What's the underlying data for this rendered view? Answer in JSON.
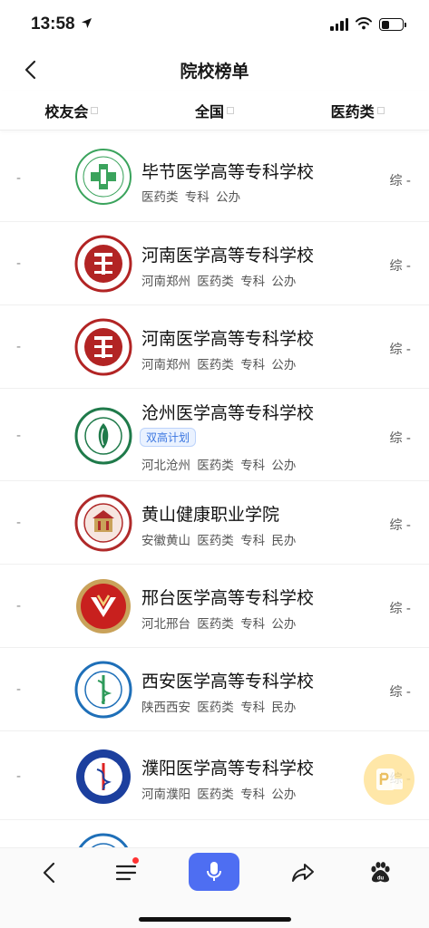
{
  "status_bar": {
    "time": "13:58"
  },
  "nav": {
    "title": "院校榜单"
  },
  "filters": [
    {
      "label": "校友会"
    },
    {
      "label": "全国"
    },
    {
      "label": "医药类"
    }
  ],
  "schools": [
    {
      "rank": "-",
      "name": "毕节医学高等专科学校",
      "meta": "医药类 专科 公办",
      "tag": "",
      "score": "综 -",
      "logo_color": "#3aa35c",
      "logo_style": "green-ring"
    },
    {
      "rank": "-",
      "name": "河南医学高等专科学校",
      "meta": "河南郑州 医药类 专科 公办",
      "tag": "",
      "score": "综 -",
      "logo_color": "#b22424",
      "logo_style": "red-seal"
    },
    {
      "rank": "-",
      "name": "河南医学高等专科学校",
      "meta": "河南郑州 医药类 专科 公办",
      "tag": "",
      "score": "综 -",
      "logo_color": "#b22424",
      "logo_style": "red-seal"
    },
    {
      "rank": "-",
      "name": "沧州医学高等专科学校",
      "meta": "河北沧州 医药类 专科 公办",
      "tag": "双高计划",
      "score": "综 -",
      "logo_color": "#1f7a4a",
      "logo_style": "green-seal"
    },
    {
      "rank": "-",
      "name": "黄山健康职业学院",
      "meta": "安徽黄山 医药类 专科 民办",
      "tag": "",
      "score": "综 -",
      "logo_color": "#b02a2a",
      "logo_style": "red-ring"
    },
    {
      "rank": "-",
      "name": "邢台医学高等专科学校",
      "meta": "河北邢台 医药类 专科 公办",
      "tag": "",
      "score": "综 -",
      "logo_color": "#c8201e",
      "logo_style": "red-gold"
    },
    {
      "rank": "-",
      "name": "西安医学高等专科学校",
      "meta": "陕西西安 医药类 专科 民办",
      "tag": "",
      "score": "综 -",
      "logo_color": "#1e6fb8",
      "logo_style": "blue-ring"
    },
    {
      "rank": "-",
      "name": "濮阳医学高等专科学校",
      "meta": "河南濮阳 医药类 专科 公办",
      "tag": "",
      "score": "综 -",
      "logo_color": "#1c3f9e",
      "logo_style": "blue-seal"
    },
    {
      "rank": "",
      "name": "",
      "meta": "",
      "tag": "",
      "score": "",
      "logo_color": "#1e6fb8",
      "logo_style": "partial"
    }
  ],
  "toolbar": {
    "icons": [
      "back-icon",
      "menu-icon",
      "microphone-icon",
      "share-icon",
      "baidu-paw-icon"
    ]
  },
  "colors": {
    "accent": "#4e6ef2",
    "tag_blue": "#3b76e0"
  }
}
